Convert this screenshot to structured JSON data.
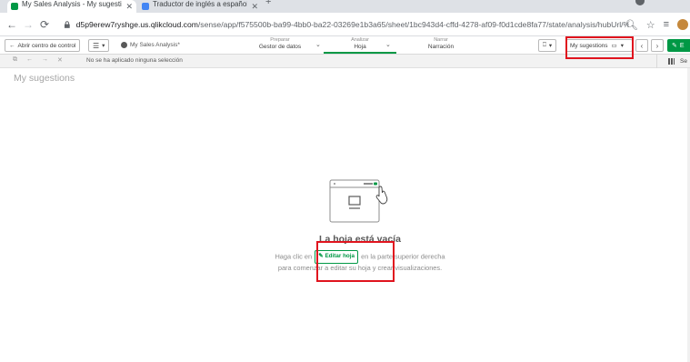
{
  "browser": {
    "tabs": [
      {
        "title": "My Sales Analysis - My sugesti...",
        "active": true,
        "favicon_color": "#009845"
      },
      {
        "title": "Traductor de inglés a español - ...",
        "active": false,
        "favicon_color": "#4285f4"
      }
    ],
    "new_tab": "+",
    "url_host": "d5p9erew7ryshge.us.qlikcloud.com",
    "url_path": "/sense/app/f575500b-ba99-4bb0-ba22-03269e1b3a65/sheet/1bc943d4-cffd-4278-af09-f0d1cde8fa77/state/analysis/hubUrl/%2Fex..."
  },
  "toolbar": {
    "back_label": "Abrir centro de control",
    "app_name": "My Sales Analysis*",
    "steps": [
      {
        "top": "Preparar",
        "label": "Gestor de datos",
        "has_menu": true,
        "active": false
      },
      {
        "top": "Analizar",
        "label": "Hoja",
        "has_menu": true,
        "active": true
      },
      {
        "top": "Narrar",
        "label": "Narración",
        "has_menu": false,
        "active": false
      }
    ],
    "sheet_name": "My sugestions",
    "edit_label": "E"
  },
  "selection_bar": {
    "text": "No se ha aplicado ninguna selección",
    "right_label": "Se"
  },
  "sheet": {
    "title": "My sugestions",
    "empty_title": "La hoja está vacía",
    "desc_before": "Haga clic en",
    "edit_button_label": "Editar hoja",
    "desc_after": "en la parte superior derecha para comenzar a editar su hoja y crear visualizaciones."
  },
  "colors": {
    "qlik_green": "#009845",
    "annotation_red": "#e0141e"
  }
}
